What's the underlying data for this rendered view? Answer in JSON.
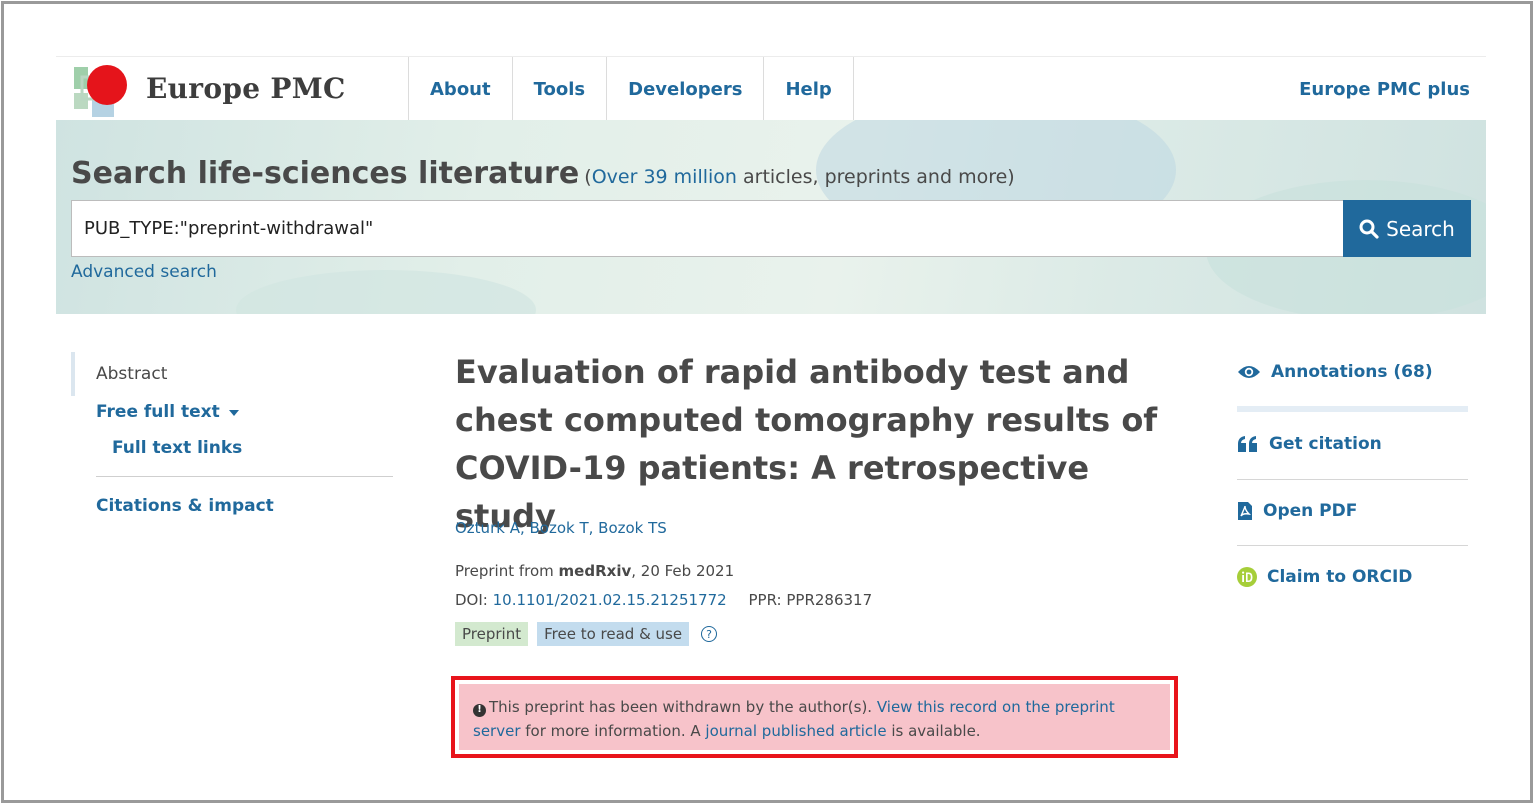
{
  "brand": {
    "name": "Europe PMC"
  },
  "nav": {
    "items": [
      {
        "label": "About"
      },
      {
        "label": "Tools"
      },
      {
        "label": "Developers"
      },
      {
        "label": "Help"
      }
    ],
    "right_link": "Europe PMC plus"
  },
  "search": {
    "heading": "Search life-sciences literature",
    "sub_open": "(",
    "sub_link": "Over 39 million",
    "sub_rest": " articles, preprints and more)",
    "query": "PUB_TYPE:\"preprint-withdrawal\"",
    "button_label": "Search",
    "advanced_label": "Advanced search"
  },
  "sidebar": {
    "abstract": "Abstract",
    "free_full_text": "Free full text",
    "full_text_links": "Full text links",
    "citations": "Citations & impact"
  },
  "article": {
    "title": "Evaluation of rapid antibody test and chest computed tomography results of COVID-19 patients: A retrospective study",
    "authors": "Ozturk A, Bozok T, Bozok TS",
    "source_prefix": "Preprint from ",
    "source": "medRxiv",
    "source_date": ", 20 Feb 2021",
    "doi_label": "DOI: ",
    "doi": "10.1101/2021.02.15.21251772",
    "ppr": "PPR: PPR286317",
    "tags": {
      "preprint": "Preprint",
      "free": "Free to read & use"
    },
    "notice": {
      "text1": "This preprint has been withdrawn by the author(s). ",
      "link1": "View this record on the preprint server",
      "text2": " for more information. A ",
      "link2": "journal published article",
      "text3": " is available."
    }
  },
  "actions": {
    "annotations": "Annotations (68)",
    "citation": "Get citation",
    "pdf": "Open PDF",
    "orcid": "Claim to ORCID"
  },
  "colors": {
    "link": "#20699c",
    "notice_bg": "#f7c3ca",
    "notice_outline": "#e8141b",
    "preprint_tag": "#d3e9cf",
    "free_tag": "#c3dcee"
  }
}
